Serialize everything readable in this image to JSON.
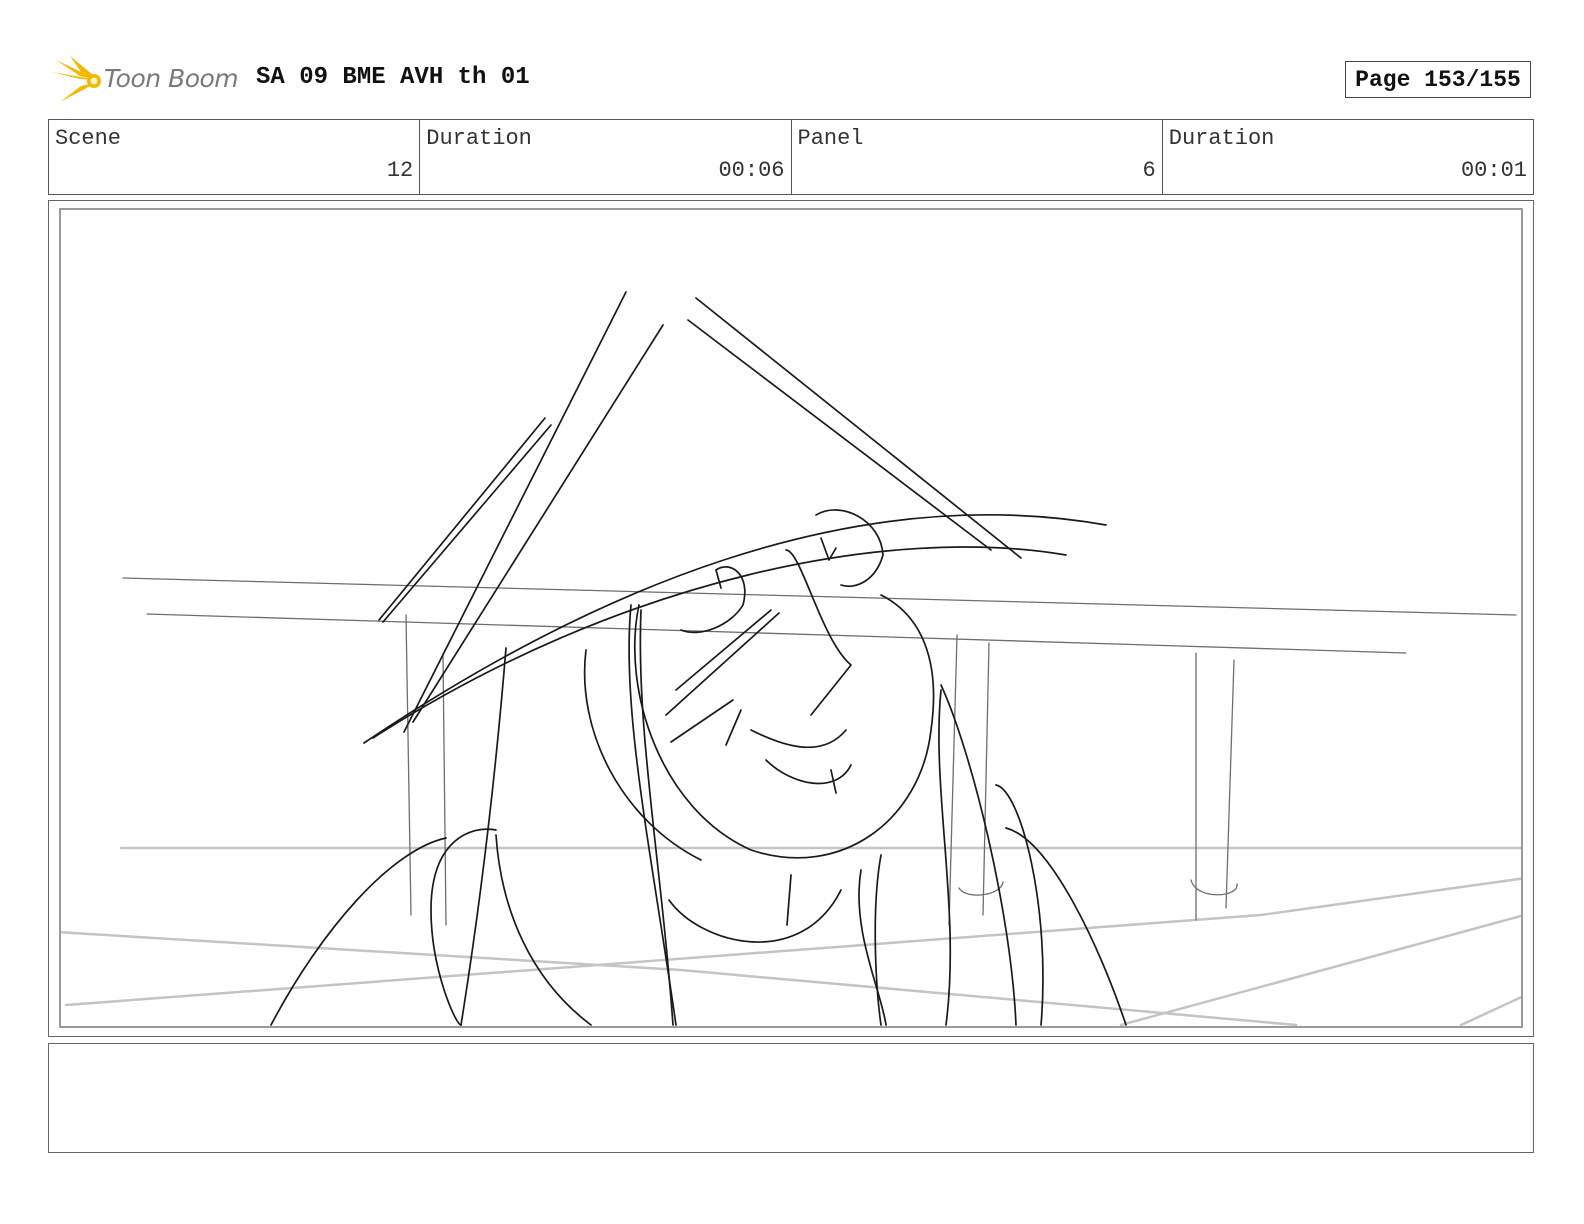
{
  "header": {
    "logo_text": "Toon Boom",
    "title": "SA 09 BME AVH th 01",
    "page": "Page 153/155"
  },
  "info": {
    "scene_label": "Scene",
    "scene_value": "12",
    "scene_duration_label": "Duration",
    "scene_duration_value": "00:06",
    "panel_label": "Panel",
    "panel_value": "6",
    "panel_duration_label": "Duration",
    "panel_duration_value": "00:01"
  },
  "colors": {
    "logo_accent": "#f5b800",
    "sketch_line": "#1a1a1a",
    "guide_line": "#bdbdbd"
  },
  "notes": ""
}
